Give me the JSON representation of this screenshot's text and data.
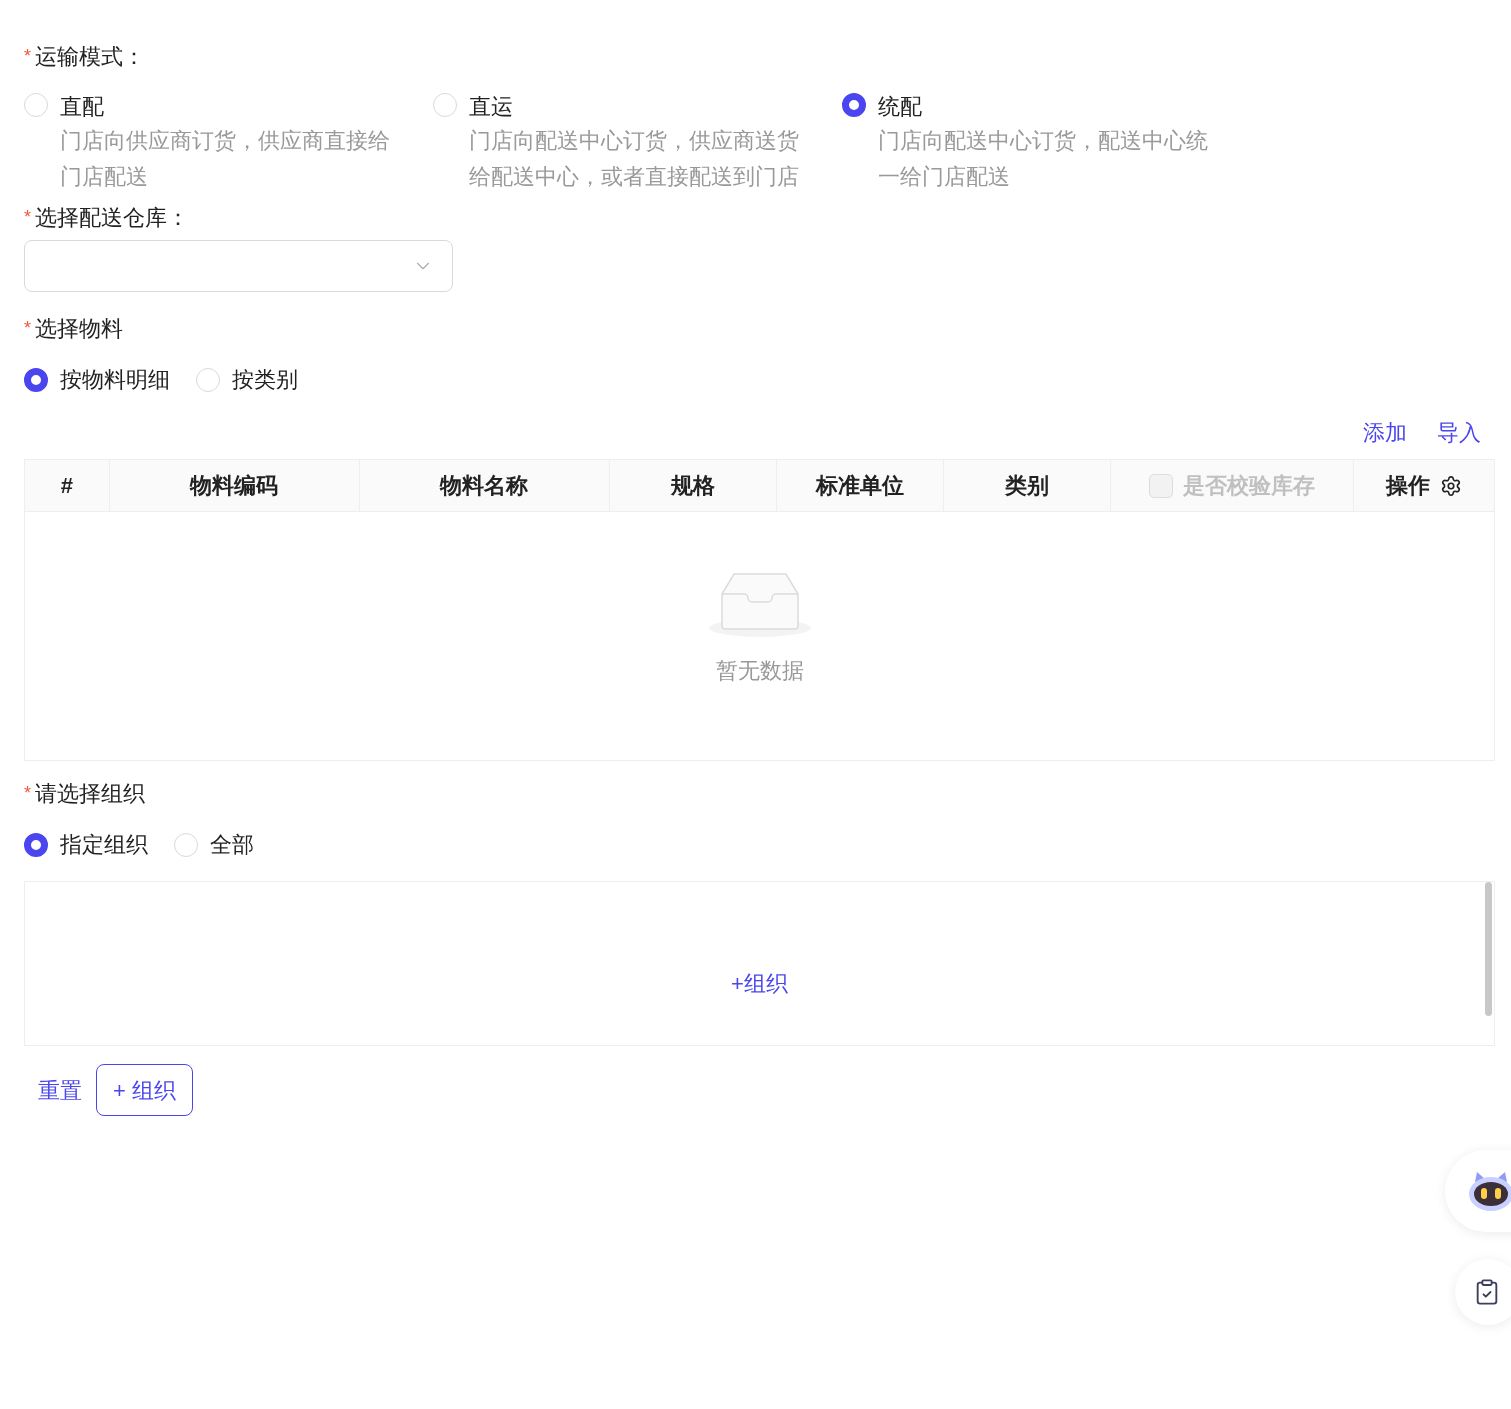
{
  "transport": {
    "label": "运输模式：",
    "required_mark": "*",
    "options": [
      {
        "title": "直配",
        "description": "门店向供应商订货，供应商直接给门店配送",
        "selected": false
      },
      {
        "title": "直运",
        "description": "门店向配送中心订货，供应商送货给配送中心，或者直接配送到门店",
        "selected": false
      },
      {
        "title": "统配",
        "description": "门店向配送中心订货，配送中心统一给门店配送",
        "selected": true
      }
    ]
  },
  "warehouse": {
    "label": "选择配送仓库：",
    "required_mark": "*"
  },
  "materials": {
    "label": "选择物料",
    "required_mark": "*",
    "options": [
      {
        "label": "按物料明细",
        "selected": true
      },
      {
        "label": "按类别",
        "selected": false
      }
    ],
    "actions": [
      "添加",
      "导入"
    ],
    "table": {
      "columns": [
        {
          "label": "#",
          "kind": "text"
        },
        {
          "label": "物料编码",
          "kind": "text"
        },
        {
          "label": "物料名称",
          "kind": "text"
        },
        {
          "label": "规格",
          "kind": "text"
        },
        {
          "label": "标准单位",
          "kind": "text"
        },
        {
          "label": "类别",
          "kind": "text"
        },
        {
          "label": "是否校验库存",
          "kind": "checkbox",
          "checked": false,
          "disabled": true
        },
        {
          "label": "操作",
          "kind": "settings"
        }
      ],
      "empty_text": "暂无数据"
    }
  },
  "organization": {
    "label": "请选择组织",
    "required_mark": "*",
    "options": [
      {
        "label": "指定组织",
        "selected": true
      },
      {
        "label": "全部",
        "selected": false
      }
    ],
    "add_link": "+组织"
  },
  "buttons": [
    {
      "label": "重置",
      "kind": "link"
    },
    {
      "label": "+ 组织",
      "kind": "outline"
    }
  ]
}
